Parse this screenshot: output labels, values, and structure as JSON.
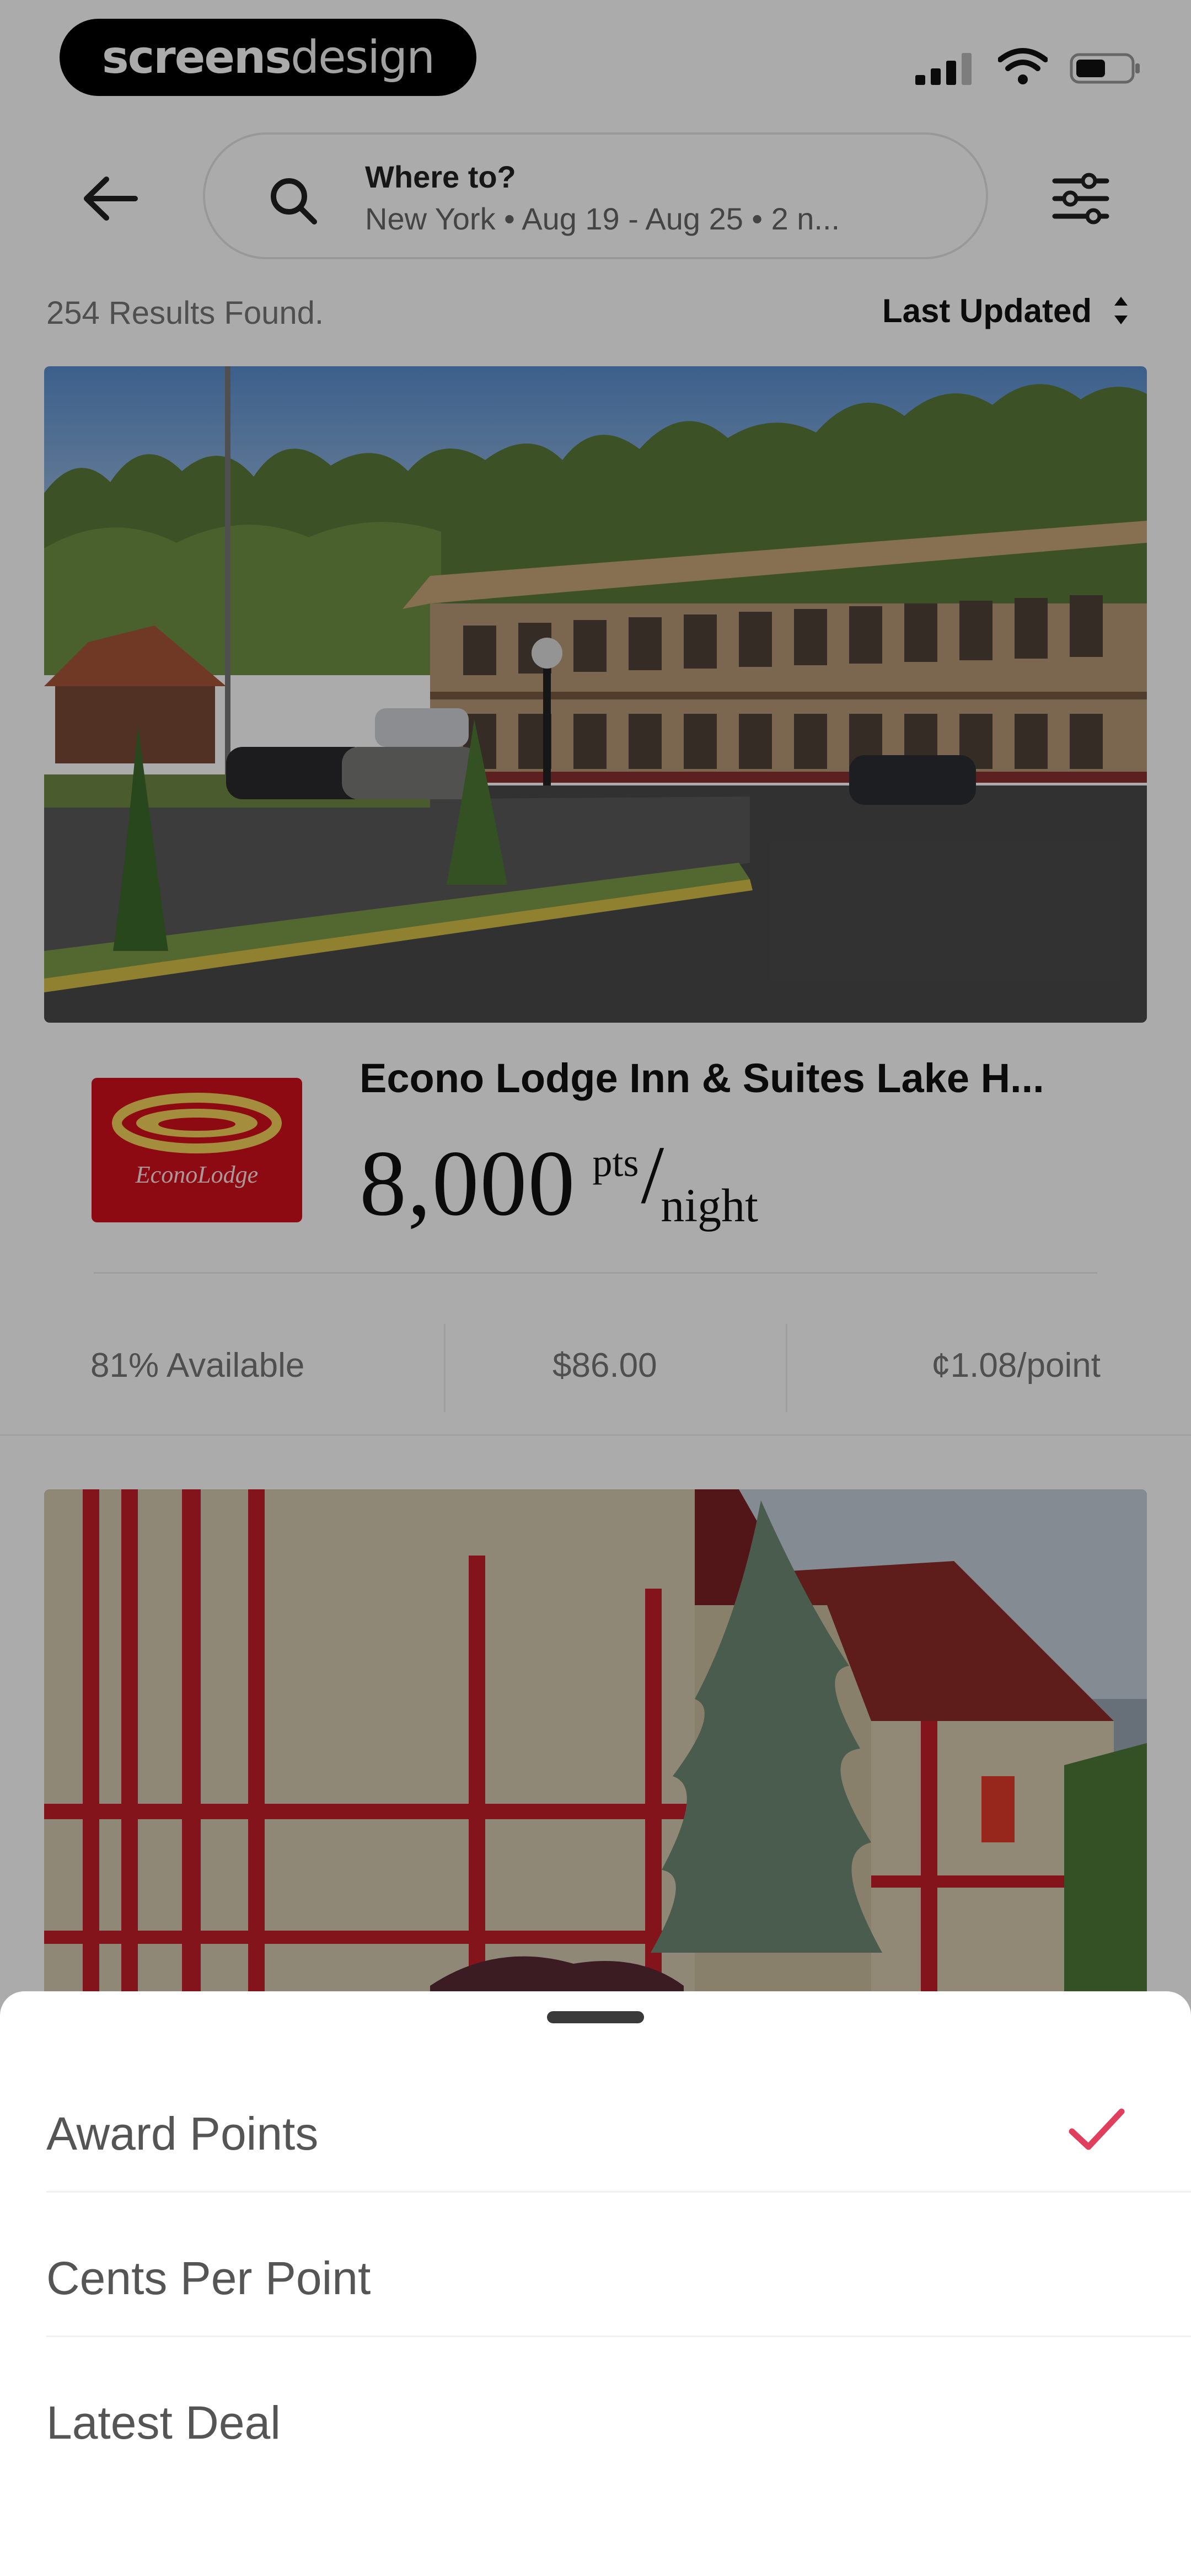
{
  "status_bar": {
    "brand_part1": "screens",
    "brand_part2": "design",
    "icons": [
      "signal-icon",
      "wifi-icon",
      "battery-icon"
    ]
  },
  "header": {
    "back_icon": "back-arrow-icon",
    "search_icon": "search-icon",
    "search_title": "Where to?",
    "search_subtitle": "New York • Aug 19 - Aug 25 • 2 n...",
    "filter_icon": "filter-sliders-icon"
  },
  "results": {
    "count_label": "254 Results Found.",
    "sort_label": "Last Updated",
    "sort_icon": "sort-arrows-icon"
  },
  "hotels": [
    {
      "name": "Econo Lodge Inn & Suites Lake H...",
      "logo_text": "EconoLodge",
      "price_value": "8,000",
      "price_unit_pts": "pts",
      "price_slash": "/",
      "price_unit_night": "night",
      "availability": "81% Available",
      "cash_price": "$86.00",
      "cents_per_point": "¢1.08/point"
    }
  ],
  "sort_sheet": {
    "options": [
      {
        "label": "Award Points",
        "selected": true
      },
      {
        "label": "Cents Per Point",
        "selected": false
      },
      {
        "label": "Latest Deal",
        "selected": false
      }
    ],
    "check_icon": "checkmark-icon"
  },
  "colors": {
    "accent": "#e0405e",
    "brand_logo": "#d3101b",
    "scrim": "rgba(0,0,0,0.33)"
  }
}
